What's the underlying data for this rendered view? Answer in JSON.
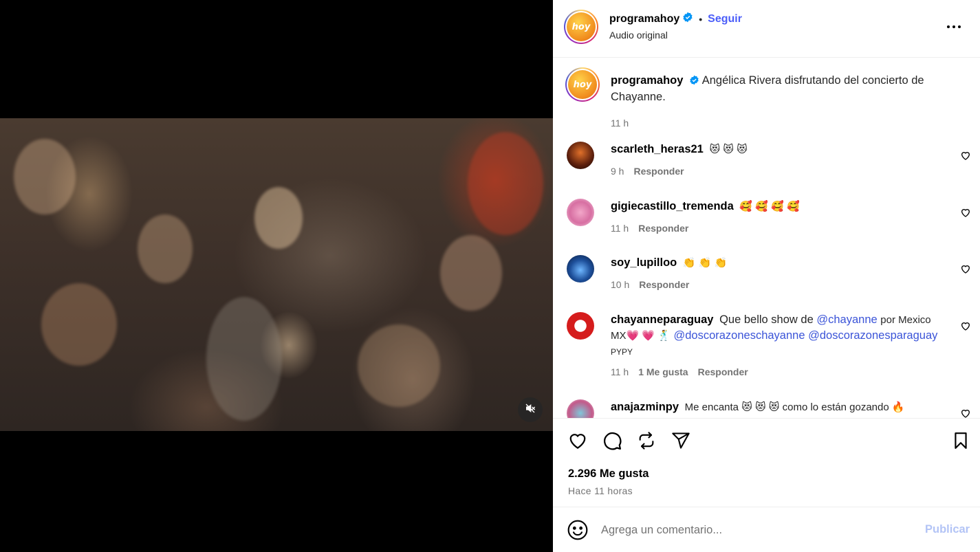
{
  "post": {
    "username": "programahoy",
    "follow_label": "Seguir",
    "separator": "•",
    "audio_label": "Audio original",
    "logo_text": "hoy",
    "caption": "Angélica Rivera disfrutando del concierto de Chayanne.",
    "caption_time": "11 h"
  },
  "comments": [
    {
      "username": "scarleth_heras21",
      "text": "😻 😻 😻",
      "time": "9 h",
      "reply_label": "Responder"
    },
    {
      "username": "gigiecastillo_tremenda",
      "text": "🥰 🥰 🥰 🥰",
      "time": "11 h",
      "reply_label": "Responder"
    },
    {
      "username": "soy_lupilloo",
      "text": "👏 👏 👏",
      "time": "10 h",
      "reply_label": "Responder"
    },
    {
      "username": "chayanneparaguay",
      "text_1": "Que bello show de",
      "mention_1": "@chayanne",
      "text_2": "por Mexico MX💗 💗 🕺",
      "mention_2": "@doscorazoneschayanne",
      "mention_3": "@doscorazonesparaguay",
      "text_3": "PYPY",
      "time": "11 h",
      "likes": "1 Me gusta",
      "reply_label": "Responder"
    },
    {
      "username": "anajazminpy",
      "text": "Me encanta 😻 😻 😻  como lo están gozando 🔥"
    }
  ],
  "actions": {
    "likes_count": "2.296 Me gusta",
    "time_ago": "Hace 11 horas"
  },
  "composer": {
    "placeholder": "Agrega un comentario...",
    "publish_label": "Publicar"
  },
  "colors": {
    "link_blue": "#4a5df9",
    "mention_blue": "#3b54d8",
    "secondary_text": "#737373",
    "publish_disabled": "#b3c4f6",
    "verified_blue": "#0095f6"
  },
  "icons": [
    "mute-icon",
    "verified-icon",
    "more-icon",
    "heart-icon",
    "comment-icon",
    "repost-icon",
    "share-icon",
    "bookmark-icon",
    "emoji-icon"
  ]
}
